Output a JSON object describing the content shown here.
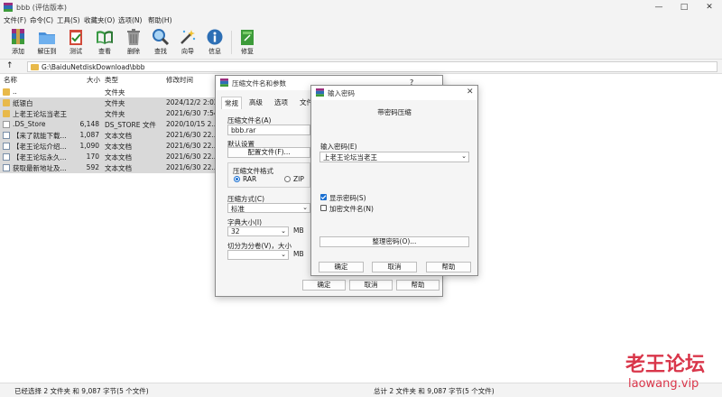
{
  "window": {
    "title": "bbb (评估版本)"
  },
  "menu": [
    "文件(F)",
    "命令(C)",
    "工具(S)",
    "收藏夹(O)",
    "选项(N)",
    "帮助(H)"
  ],
  "toolbar": [
    "添加",
    "解压到",
    "测试",
    "查看",
    "删除",
    "查找",
    "向导",
    "信息",
    "修复"
  ],
  "address": {
    "up": "↑",
    "path": "G:\\BaiduNetdiskDownload\\bbb"
  },
  "columns": [
    "名称",
    "大小",
    "类型",
    "修改时间"
  ],
  "files": [
    {
      "name": "..",
      "size": "",
      "type": "文件夹",
      "date": ""
    },
    {
      "name": "纸银白",
      "size": "",
      "type": "文件夹",
      "date": "2024/12/2 2:02"
    },
    {
      "name": "上老王论坛当老王",
      "size": "",
      "type": "文件夹",
      "date": "2021/6/30 7:54"
    },
    {
      "name": ".DS_Store",
      "size": "6,148",
      "type": "DS_STORE 文件",
      "date": "2020/10/15 2..."
    },
    {
      "name": "【来了就能下载...",
      "size": "1,087",
      "type": "文本文档",
      "date": "2021/6/30 22..."
    },
    {
      "name": "【老王论坛介绍...",
      "size": "1,090",
      "type": "文本文档",
      "date": "2021/6/30 22..."
    },
    {
      "name": "【老王论坛永久...",
      "size": "170",
      "type": "文本文档",
      "date": "2021/6/30 22..."
    },
    {
      "name": "获取最新地址及...",
      "size": "592",
      "type": "文本文档",
      "date": "2021/6/30 22..."
    }
  ],
  "status": {
    "left": "已经选择 2 文件夹 和 9,087 字节(5 个文件)",
    "right": "总计 2 文件夹 和 9,087 字节(5 个文件)"
  },
  "archive_dialog": {
    "title": "压缩文件名和参数",
    "help_mark": "?",
    "tabs": [
      "常规",
      "高级",
      "选项",
      "文件"
    ],
    "filename_label": "压缩文件名(A)",
    "filename": "bbb.rar",
    "defaults_label": "默认设置",
    "profiles_btn": "配置文件(F)...",
    "format_label": "压缩文件格式",
    "format_rar": "RAR",
    "format_zip": "ZIP",
    "method_label": "压缩方式(C)",
    "method": "标准",
    "dict_label": "字典大小(I)",
    "dict": "32",
    "dict_unit": "MB",
    "split_label": "切分为分卷(V)，大小",
    "split_unit": "MB",
    "ok": "确定",
    "cancel": "取消",
    "help": "帮助"
  },
  "password_dialog": {
    "title": "输入密码",
    "heading": "带密码压缩",
    "enter_label": "输入密码(E)",
    "password": "上老王论坛当老王",
    "show_pw": "显示密码(S)",
    "encrypt_names": "加密文件名(N)",
    "organize": "整理密码(O)...",
    "ok": "确定",
    "cancel": "取消",
    "help": "帮助"
  },
  "watermark": {
    "line1": "老王论坛",
    "line2": "laowang.vip"
  },
  "colors": {
    "folder": "#e8b94a",
    "watermark": "#d9364a",
    "selection": "#d9d9d9",
    "accent": "#1a6fd1"
  }
}
